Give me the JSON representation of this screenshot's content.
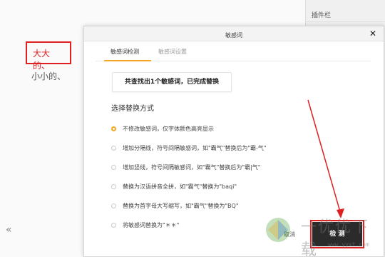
{
  "background": {
    "selected_text": "大大的、",
    "other_text": "小小的、",
    "collapse_glyph": "«"
  },
  "plugin_panel": {
    "title": "插件栏"
  },
  "dialog": {
    "title": "敏感词",
    "close_glyph": "✕",
    "tabs": [
      {
        "label": "敏感词检测",
        "active": true
      },
      {
        "label": "敏感词设置",
        "active": false
      }
    ],
    "result_text": "共查找出1个敏感词，已完成替换",
    "section_title": "选择替换方式",
    "options": [
      {
        "label": "不修改敏感词，仅字体颜色高亮显示",
        "selected": true
      },
      {
        "label": "增加分隔线，符号间隔敏感词，如\"霸气\"替换后为\"霸-气\"",
        "selected": false
      },
      {
        "label": "增加竖线，符号间隔敏感词，如\"霸气\"替换后为\"霸|气\"",
        "selected": false
      },
      {
        "label": "替换为汉语拼音全拼，如\"霸气\"替换为\"baqi\"",
        "selected": false
      },
      {
        "label": "替换为首字母大写缩写，如\"霸气\"替换为\"BQ\"",
        "selected": false
      },
      {
        "label": "将敏感词替换为\"＊＊\"",
        "selected": false
      }
    ],
    "cancel_label": "取消",
    "check_label": "检 测"
  },
  "watermark": {
    "text": "一优优下载",
    "url": "www.yyxt.com"
  },
  "colors": {
    "accent": "#f5a623",
    "highlight_red": "#e02020",
    "primary_button": "#2b2b2b"
  }
}
